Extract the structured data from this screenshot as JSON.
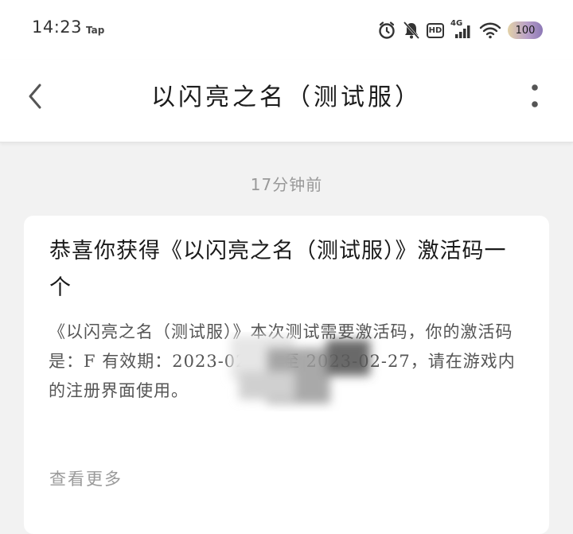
{
  "status_bar": {
    "time": "14:23",
    "app_label": "Tap",
    "network_label": "4G",
    "hd_label": "HD",
    "battery_level": "100"
  },
  "header": {
    "title": "以闪亮之名（测试服）"
  },
  "messages": [
    {
      "timestamp": "17分钟前",
      "title": "恭喜你获得《以闪亮之名（测试服）》激活码一个",
      "body": "《以闪亮之名（测试服）》本次测试需要激活码，你的激活码是：F              有效期：2023-02-21 至 2023-02-27，请在游戏内的注册界面使用。",
      "view_more": "查看更多"
    }
  ],
  "colors": {
    "background": "#f2f2f2",
    "card": "#ffffff",
    "muted_text": "#999999"
  }
}
